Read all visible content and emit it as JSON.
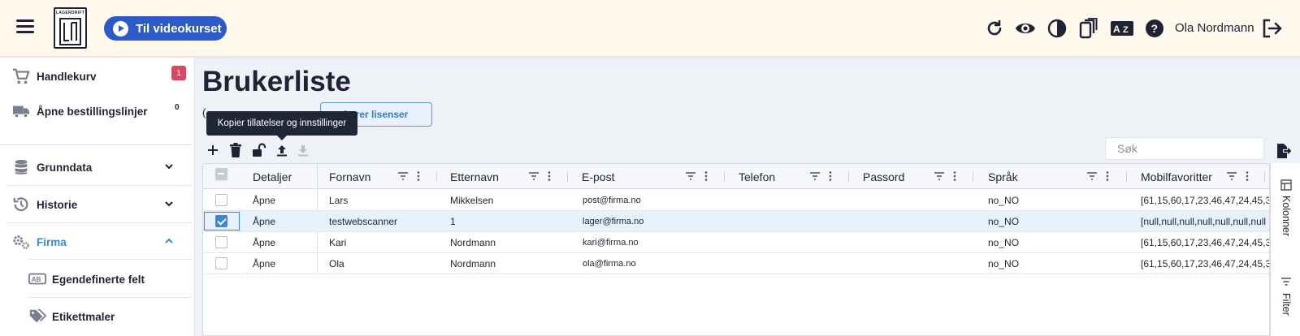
{
  "header": {
    "logo_text": "LAGERDRIFT",
    "video_button_label": "Til videokurset",
    "user_name": "Ola Nordmann",
    "icons": [
      "refresh-icon",
      "eye-icon",
      "contrast-icon",
      "devices-icon",
      "language-icon",
      "help-icon",
      "logout-icon"
    ]
  },
  "sidebar": {
    "items": [
      {
        "label": "Handlekurv",
        "badge": "1",
        "icon": "cart-icon"
      },
      {
        "label": "Åpne bestillingslinjer",
        "badge": "0",
        "icon": "truck-icon"
      },
      {
        "label": "Grunndata",
        "icon": "database-icon",
        "expanded": false
      },
      {
        "label": "Historie",
        "icon": "history-icon",
        "expanded": false
      },
      {
        "label": "Firma",
        "icon": "gears-icon",
        "expanded": true,
        "active_color": "#3a86d9"
      },
      {
        "label": "Egendefinerte felt",
        "icon": "ab-field-icon"
      },
      {
        "label": "Etikettmaler",
        "icon": "tags-icon"
      }
    ]
  },
  "main": {
    "title": "Brukerliste",
    "subtext": "(",
    "register_button_label": "istrer lisenser",
    "tooltip": "Kopier tillatelser og innstillinger",
    "search_placeholder": "Søk"
  },
  "grid": {
    "columns": [
      "Detaljer",
      "Fornavn",
      "Etternavn",
      "E-post",
      "Telefon",
      "Passord",
      "Språk",
      "Mobilfavoritter"
    ],
    "rows": [
      {
        "checked": false,
        "detaljer": "Åpne",
        "fornavn": "Lars",
        "etternavn": "Mikkelsen",
        "epost": "post@firma.no",
        "telefon": "",
        "passord": "",
        "sprak": "no_NO",
        "mobil": "[61,15,60,17,23,46,47,24,45,3,"
      },
      {
        "checked": true,
        "detaljer": "Åpne",
        "fornavn": "testwebscanner",
        "etternavn": "1",
        "epost": "lager@firma.no",
        "telefon": "",
        "passord": "",
        "sprak": "no_NO",
        "mobil": "[null,null,null,null,null,null,null"
      },
      {
        "checked": false,
        "detaljer": "Åpne",
        "fornavn": "Kari",
        "etternavn": "Nordmann",
        "epost": "kari@firma.no",
        "telefon": "",
        "passord": "",
        "sprak": "no_NO",
        "mobil": "[61,15,60,17,23,46,47,24,45,3,"
      },
      {
        "checked": false,
        "detaljer": "Åpne",
        "fornavn": "Ola",
        "etternavn": "Nordmann",
        "epost": "ola@firma.no",
        "telefon": "",
        "passord": "",
        "sprak": "no_NO",
        "mobil": "[61,15,60,17,23,46,47,24,45,3,"
      }
    ]
  },
  "side_panel": {
    "columns_label": "Kolonner",
    "filter_label": "Filter"
  },
  "colors": {
    "header_bg": "#fff8ec",
    "primary_button": "#2d5ac9",
    "badge_red": "#e3435f",
    "accent_blue": "#3a86d9",
    "page_bg": "#eef1f6"
  }
}
